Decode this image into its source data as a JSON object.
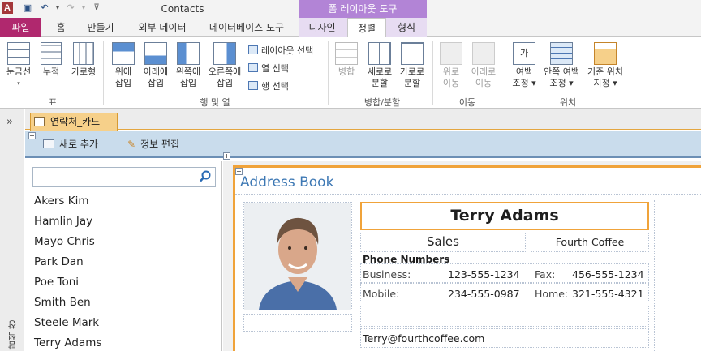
{
  "window": {
    "title": "Contacts",
    "app_icon": "A",
    "context_header": "폼 레이아웃 도구"
  },
  "tabs": {
    "file": "파일",
    "home": "홈",
    "create": "만들기",
    "external": "외부 데이터",
    "dbtools": "데이터베이스 도구",
    "design": "디자인",
    "arrange": "정렬",
    "format": "형식"
  },
  "ribbon": {
    "gridlines": "눈금선",
    "stacked": "누적",
    "tabular": "가로형",
    "insert_above_1": "위에",
    "insert_above_2": "삽입",
    "insert_below_1": "아래에",
    "insert_below_2": "삽입",
    "insert_left_1": "왼쪽에",
    "insert_left_2": "삽입",
    "insert_right_1": "오른쪽에",
    "insert_right_2": "삽입",
    "select_layout": "레이아웃 선택",
    "select_column": "열 선택",
    "select_row": "행 선택",
    "merge": "병합",
    "split_v_1": "세로로",
    "split_v_2": "분할",
    "split_h_1": "가로로",
    "split_h_2": "분할",
    "move_up_1": "위로",
    "move_up_2": "이동",
    "move_down_1": "아래로",
    "move_down_2": "이동",
    "margins_1": "여백",
    "margins_2": "조정",
    "padding_1": "안쪽 여백",
    "padding_2": "조정",
    "anchoring_1": "기준 위치",
    "anchoring_2": "지정",
    "group_table": "표",
    "group_rows_cols": "행 및 열",
    "group_merge_split": "병합/분할",
    "group_move": "이동",
    "group_position": "위치",
    "margins_icon_text": "가"
  },
  "nav": {
    "chevron": "»",
    "pane_label": "탐색 창"
  },
  "document": {
    "tab_label": "연락처_카드"
  },
  "toolbar": {
    "add_new": "새로 추가",
    "edit_info": "정보 편집"
  },
  "list": {
    "search_placeholder": "",
    "contacts": [
      "Akers Kim",
      "Hamlin Jay",
      "Mayo Chris",
      "Park Dan",
      "Poe Toni",
      "Smith Ben",
      "Steele Mark",
      "Terry Adams"
    ]
  },
  "form": {
    "title": "Address Book",
    "name": "Terry Adams",
    "department": "Sales",
    "company": "Fourth Coffee",
    "phone_heading": "Phone Numbers",
    "business_label": "Business:",
    "business": "123-555-1234",
    "fax_label": "Fax:",
    "fax": "456-555-1234",
    "mobile_label": "Mobile:",
    "mobile": "234-555-0987",
    "home_label": "Home:",
    "home": "321-555-4321",
    "email": "Terry@fourthcoffee.com"
  },
  "colors": {
    "file_tab": "#b0286e",
    "context": "#b284d6",
    "accent_orange": "#f0a33a",
    "title_blue": "#3d78b4"
  }
}
